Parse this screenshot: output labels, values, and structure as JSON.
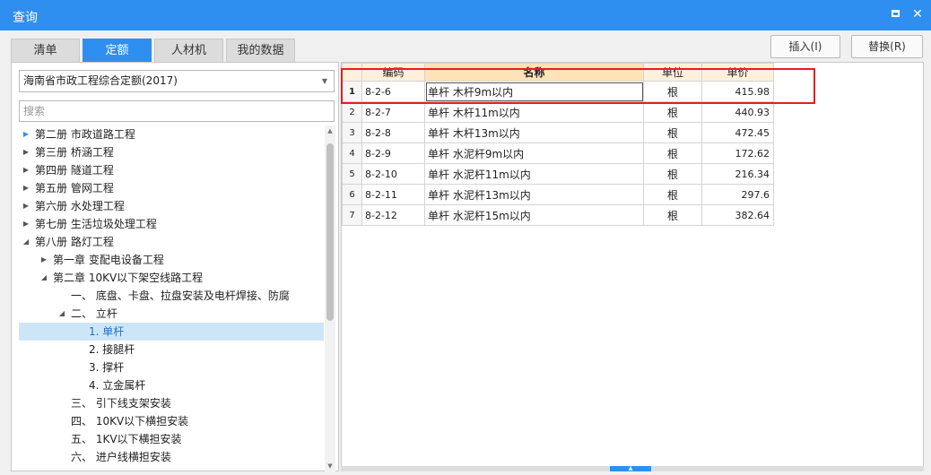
{
  "window": {
    "title": "查询",
    "maximize_icon": "maximize-icon",
    "close_icon": "close-icon",
    "accent": "#2f8ff0"
  },
  "tabs": [
    {
      "label": "清单",
      "active": false
    },
    {
      "label": "定额",
      "active": true
    },
    {
      "label": "人材机",
      "active": false
    },
    {
      "label": "我的数据",
      "active": false
    }
  ],
  "actions": {
    "insert_label": "插入(I)",
    "replace_label": "替换(R)"
  },
  "library": {
    "selected": "海南省市政工程综合定额(2017)"
  },
  "search": {
    "placeholder": "搜索",
    "value": ""
  },
  "tree": [
    {
      "label": "第二册 市政道路工程",
      "level": 0,
      "state": "collapsed-current"
    },
    {
      "label": "第三册 桥涵工程",
      "level": 0,
      "state": "collapsed"
    },
    {
      "label": "第四册 隧道工程",
      "level": 0,
      "state": "collapsed"
    },
    {
      "label": "第五册 管网工程",
      "level": 0,
      "state": "collapsed"
    },
    {
      "label": "第六册 水处理工程",
      "level": 0,
      "state": "collapsed"
    },
    {
      "label": "第七册 生活垃圾处理工程",
      "level": 0,
      "state": "collapsed"
    },
    {
      "label": "第八册 路灯工程",
      "level": 0,
      "state": "expanded"
    },
    {
      "label": "第一章 变配电设备工程",
      "level": 1,
      "state": "collapsed"
    },
    {
      "label": "第二章 10KV以下架空线路工程",
      "level": 1,
      "state": "expanded"
    },
    {
      "label": "一、 底盘、卡盘、拉盘安装及电杆焊接、防腐",
      "level": 2,
      "state": "leaf"
    },
    {
      "label": "二、 立杆",
      "level": 2,
      "state": "expanded"
    },
    {
      "label": "1. 单杆",
      "level": 3,
      "state": "selected"
    },
    {
      "label": "2. 接腿杆",
      "level": 3,
      "state": "leaf"
    },
    {
      "label": "3. 撑杆",
      "level": 3,
      "state": "leaf"
    },
    {
      "label": "4. 立金属杆",
      "level": 3,
      "state": "leaf"
    },
    {
      "label": "三、 引下线支架安装",
      "level": 2,
      "state": "leaf"
    },
    {
      "label": "四、 10KV以下横担安装",
      "level": 2,
      "state": "leaf"
    },
    {
      "label": "五、 1KV以下横担安装",
      "level": 2,
      "state": "leaf"
    },
    {
      "label": "六、 进户线横担安装",
      "level": 2,
      "state": "leaf"
    }
  ],
  "grid": {
    "headers": {
      "code": "编码",
      "name": "名称",
      "unit": "单位",
      "price": "单价"
    },
    "rows": [
      {
        "idx": "1",
        "code": "8-2-6",
        "name": "单杆 木杆9m以内",
        "unit": "根",
        "price": "415.98"
      },
      {
        "idx": "2",
        "code": "8-2-7",
        "name": "单杆 木杆11m以内",
        "unit": "根",
        "price": "440.93"
      },
      {
        "idx": "3",
        "code": "8-2-8",
        "name": "单杆 木杆13m以内",
        "unit": "根",
        "price": "472.45"
      },
      {
        "idx": "4",
        "code": "8-2-9",
        "name": "单杆 水泥杆9m以内",
        "unit": "根",
        "price": "172.62"
      },
      {
        "idx": "5",
        "code": "8-2-10",
        "name": "单杆 水泥杆11m以内",
        "unit": "根",
        "price": "216.34"
      },
      {
        "idx": "6",
        "code": "8-2-11",
        "name": "单杆 水泥杆13m以内",
        "unit": "根",
        "price": "297.6"
      },
      {
        "idx": "7",
        "code": "8-2-12",
        "name": "单杆 水泥杆15m以内",
        "unit": "根",
        "price": "382.64"
      }
    ],
    "highlight_color": "#e02020"
  }
}
